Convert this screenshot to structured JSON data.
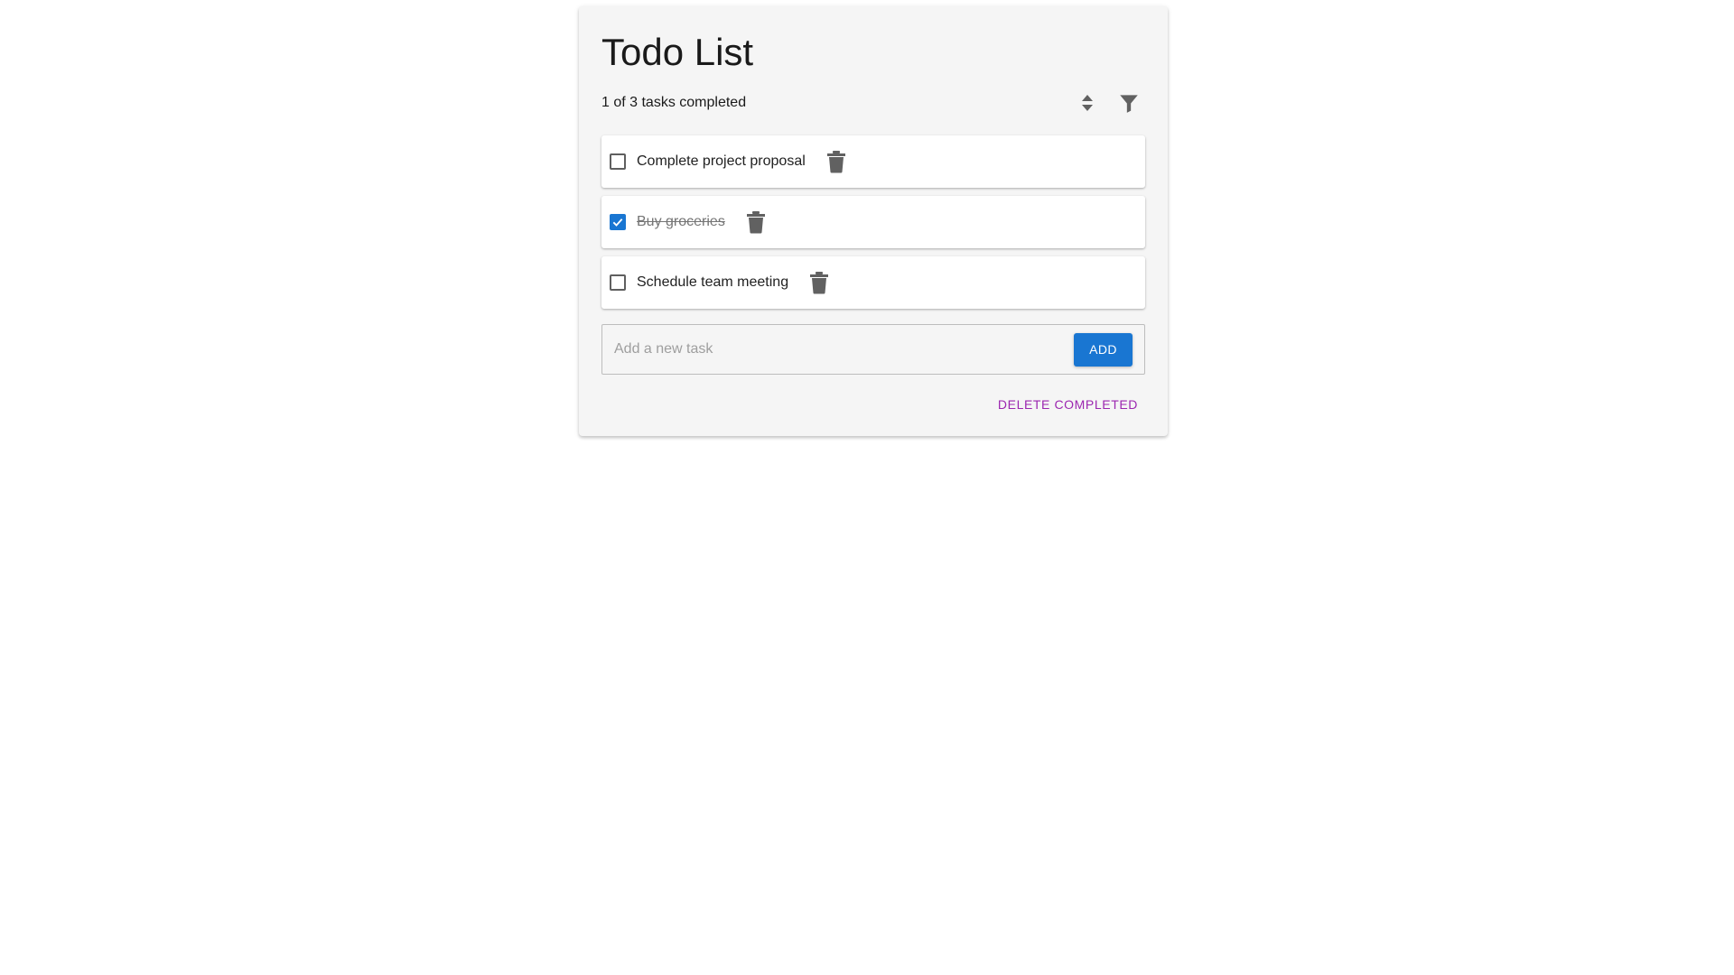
{
  "header": {
    "title": "Todo List",
    "summary": "1 of 3 tasks completed",
    "sort_icon": "sort-icon",
    "filter_icon": "filter-icon"
  },
  "tasks": [
    {
      "text": "Complete project proposal",
      "completed": false
    },
    {
      "text": "Buy groceries",
      "completed": true
    },
    {
      "text": "Schedule team meeting",
      "completed": false
    }
  ],
  "add_task": {
    "placeholder": "Add a new task",
    "value": "",
    "button_label": "ADD"
  },
  "footer": {
    "delete_completed_label": "DELETE COMPLETED"
  },
  "colors": {
    "primary": "#1976d2",
    "secondary": "#9c27b0",
    "icon": "#616161",
    "card_background": "#f5f5f5"
  }
}
